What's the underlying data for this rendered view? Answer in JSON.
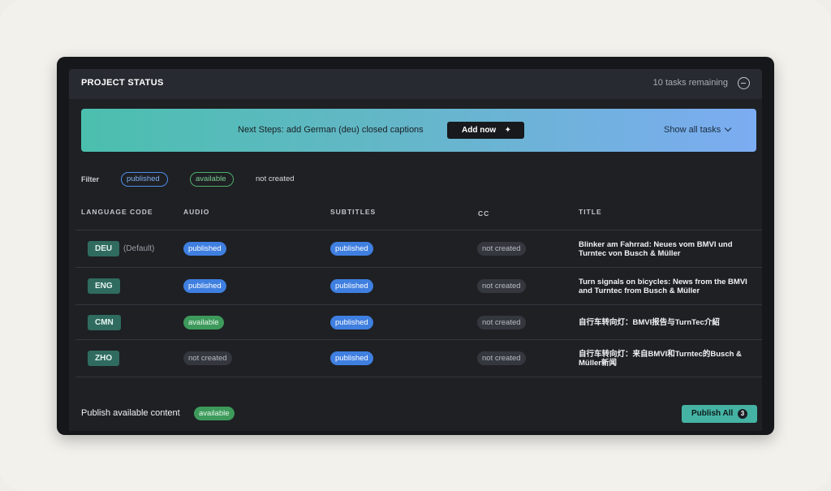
{
  "header": {
    "title": "PROJECT STATUS",
    "tasks_remaining": "10 tasks remaining"
  },
  "banner": {
    "text": "Next Steps: add German (deu) closed captions",
    "add_button": "Add now",
    "show_all": "Show all tasks"
  },
  "filter": {
    "label": "Filter",
    "chips": [
      "published",
      "available",
      "not created"
    ]
  },
  "table": {
    "columns": [
      "LANGUAGE CODE",
      "AUDIO",
      "SUBTITLES",
      "CC",
      "TITLE"
    ],
    "rows": [
      {
        "code": "DEU",
        "default": "(Default)",
        "audio": "published",
        "subtitles": "published",
        "cc": "not created",
        "title": "Blinker am Fahrrad: Neues vom BMVI und Turntec von Busch & Müller"
      },
      {
        "code": "ENG",
        "default": "",
        "audio": "published",
        "subtitles": "published",
        "cc": "not created",
        "title": "Turn signals on bicycles: News from the BMVI and Turntec from Busch & Müller"
      },
      {
        "code": "CMN",
        "default": "",
        "audio": "available",
        "subtitles": "published",
        "cc": "not created",
        "title": "自行车转向灯：BMVI报告与TurnTec介紹"
      },
      {
        "code": "ZHO",
        "default": "",
        "audio": "not created",
        "subtitles": "published",
        "cc": "not created",
        "title": "自行车转向灯：来自BMVI和Turntec的Busch & Müller新闻"
      }
    ]
  },
  "footer": {
    "text": "Publish available content",
    "chip": "available",
    "publish_button": "Publish All",
    "publish_count": "3"
  },
  "colors": {
    "accent_published": "#3f7fe0",
    "accent_available": "#3d9a5b",
    "accent_teal": "#45b3a4"
  }
}
